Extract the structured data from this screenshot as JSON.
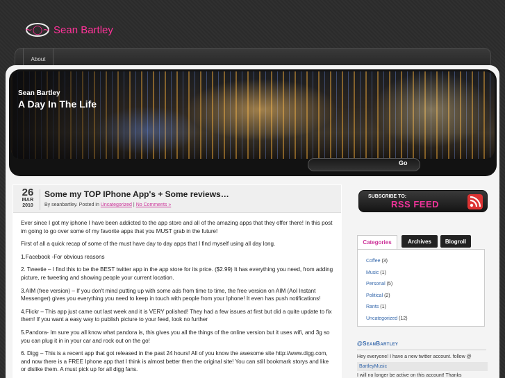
{
  "site": {
    "logo_symbol": "~◯~",
    "name": "Sean Bartley",
    "header_subtitle": "Sean Bartley",
    "header_title": "A Day In The Life"
  },
  "nav": {
    "items": [
      {
        "label": "About"
      }
    ]
  },
  "search": {
    "placeholder": "",
    "button": "Go"
  },
  "post": {
    "date": {
      "day": "26",
      "month": "MAR",
      "year": "2010"
    },
    "title": "Some my TOP IPhone App's + Some reviews…",
    "meta": {
      "prefix": "By seanbartley. Posted in",
      "category": "Uncategorized",
      "separator": "|",
      "comments": "No Comments »"
    },
    "paragraphs": [
      "Ever since I got my iphone I have been addicted to the app store and all of the amazing apps that they offer there! In this post im going to go over some of my favorite apps that you MUST grab in the future!",
      "First of all a quick recap of some of the must have day to day apps that I find myself using all day long.",
      "1.Facebook -For obvious reasons",
      "2. Tweetie – I find this to be the BEST twitter app in the app store for its price. ($2.99) It has everything you need, from adding picture, re tweeting and showing people your current location.",
      "3.AIM (free version) – If you don't mind putting up with some ads from time to time, the free version on AIM (Aol Instant Messenger) gives you everything you need to keep in touch with people from your Iphone! It even has push notifications!",
      "4.Flickr – This app just came out last week and it is VERY polished! They had a few issues at first but did a quite update to fix them! If you want a easy way to publish picture to your feed, look no further",
      "5.Pandora- Im sure you all know what pandora is, this gives you all the things of the online version but it uses wifi, and 3g so you can plug it in in your car and rock out on the go!",
      "6. Digg – This is a recent app that got released in the past 24 hours! All of you know the awesome site http://www.digg.com, and now there is a FREE Iphone app that I think is almost better then the original site! You can still bookmark storys and like or dislike them. A must pick up for all digg fans."
    ]
  },
  "sidebar": {
    "rss": {
      "subscribe": "SUBSCRIBE TO:",
      "feed": "RSS FEED",
      "icon": "rss-icon"
    },
    "tabs": [
      {
        "label": "Categories"
      },
      {
        "label": "Archives"
      },
      {
        "label": "Blogroll"
      }
    ],
    "categories": [
      {
        "name": "Coffee",
        "count": "(3)"
      },
      {
        "name": "Music",
        "count": "(1)"
      },
      {
        "name": "Personal",
        "count": "(5)"
      },
      {
        "name": "Political",
        "count": "(2)"
      },
      {
        "name": "Rants",
        "count": "(1)"
      },
      {
        "name": "Uncategorized",
        "count": "(12)"
      }
    ],
    "twitter": {
      "title": "@SeanBartley",
      "tweet1": "Hey everyone! I have a new twitter account. follow @",
      "user": "BartleyMusic",
      "tweet2": "I will no longer be active on this account! Thanks"
    }
  },
  "colors": {
    "accent": "#ff3399",
    "link": "#3366aa",
    "background": "#2b2b2b"
  }
}
